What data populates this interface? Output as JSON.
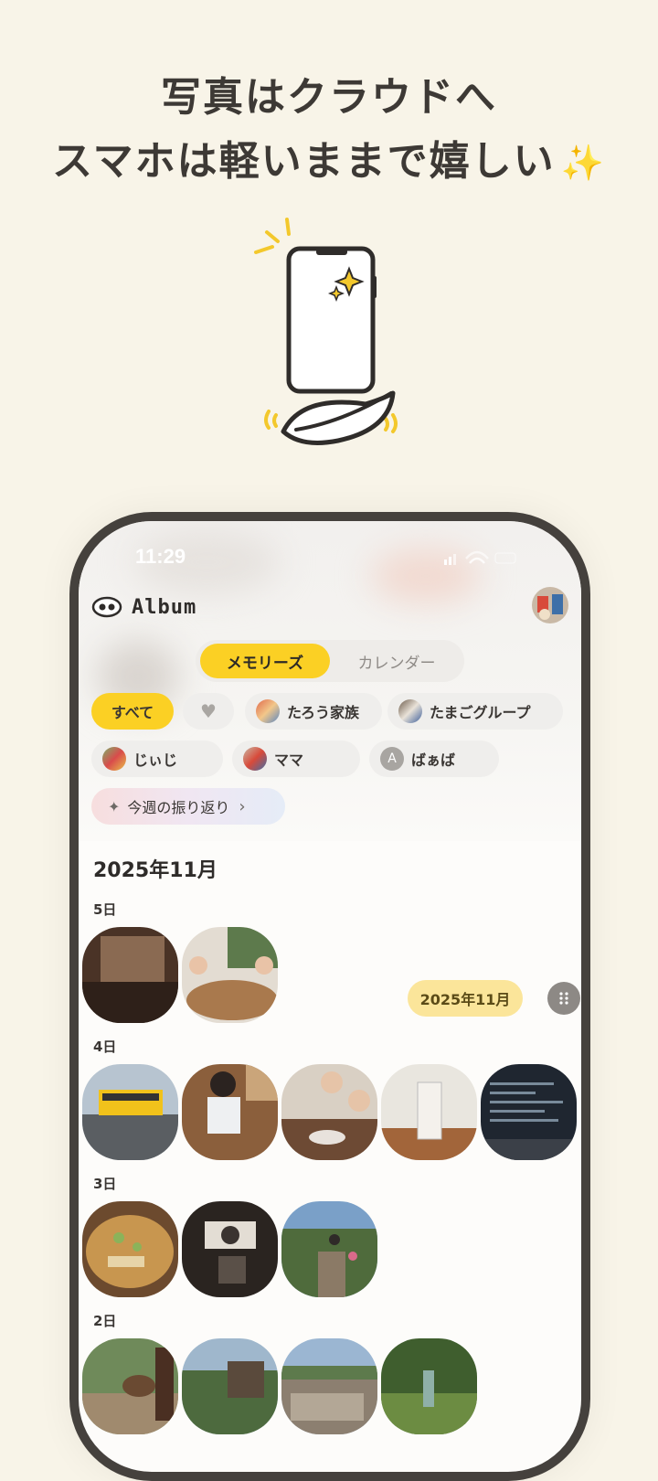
{
  "headline": {
    "line1": "写真はクラウドへ",
    "line2": "スマホは軽いままで嬉しい",
    "sparkle": "✨"
  },
  "status_bar": {
    "time": "11:29"
  },
  "app": {
    "title": "Album",
    "logo_icon": "eyes-icon"
  },
  "segmented": {
    "active": "メモリーズ",
    "inactive": "カレンダー"
  },
  "filters": {
    "all": "すべて",
    "favorite_icon": "heart-icon",
    "groups": [
      "たろう家族",
      "たまごグループ",
      "じぃじ",
      "ママ",
      "ばぁば"
    ],
    "baaba_initial": "A",
    "review": "今週の振り返り",
    "review_icon": "sparkle-icon",
    "review_chevron": "›"
  },
  "timeline": {
    "month": "2025年11月",
    "days": [
      {
        "label": "5日",
        "photos": 2
      },
      {
        "label": "4日",
        "photos": 5
      },
      {
        "label": "3日",
        "photos": 3
      },
      {
        "label": "2日",
        "photos": 4
      }
    ]
  },
  "scrubber": {
    "label": "2025年11月",
    "icon": "grip-dots-icon"
  },
  "colors": {
    "background": "#f8f4e8",
    "accent": "#fbd024",
    "frame": "#45413d"
  }
}
